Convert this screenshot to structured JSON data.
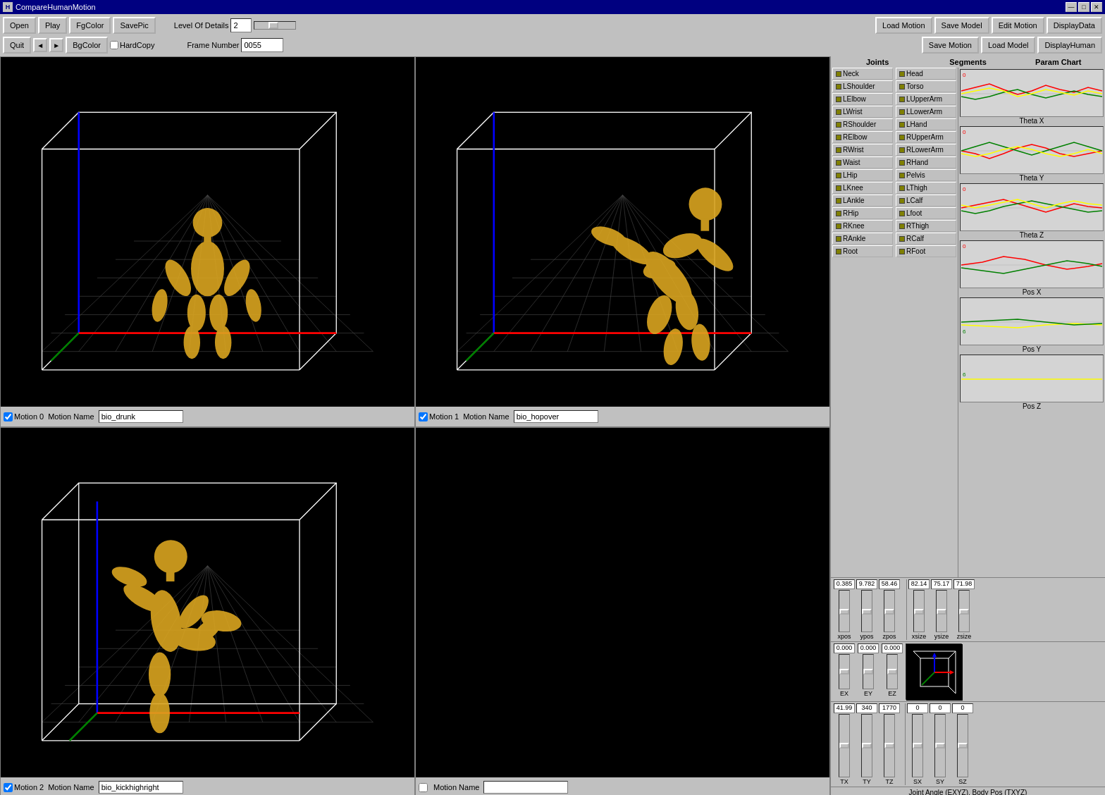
{
  "titleBar": {
    "title": "CompareHumanMotion",
    "minBtn": "—",
    "maxBtn": "□",
    "closeBtn": "✕"
  },
  "toolbar": {
    "row1": {
      "openBtn": "Open",
      "playBtn": "Play",
      "fgColorBtn": "FgColor",
      "savePicBtn": "SavePic",
      "levelLabel": "Level Of Details",
      "levelValue": "2",
      "loadMotionBtn": "Load Motion",
      "saveModelBtn": "Save Model",
      "editMotionBtn": "Edit Motion",
      "displayDataBtn": "DisplayData"
    },
    "row2": {
      "quitBtn": "Quit",
      "prevBtn": "◄",
      "nextBtn": "►",
      "bgColorBtn": "BgColor",
      "hardCopyChk": "HardCopy",
      "frameLabel": "Frame Number",
      "frameValue": "0055",
      "saveMotionBtn": "Save Motion",
      "loadModelBtn": "Load Model",
      "displayHumanBtn": "DisplayHuman"
    }
  },
  "panels": [
    {
      "id": "panel0",
      "motionId": "0",
      "motionLabel": "Motion 0",
      "motionName": "bio_drunk",
      "hasChecked": true
    },
    {
      "id": "panel1",
      "motionId": "1",
      "motionLabel": "Motion 1",
      "motionName": "bio_hopover",
      "hasChecked": true
    },
    {
      "id": "panel2",
      "motionId": "2",
      "motionLabel": "Motion 2",
      "motionName": "bio_kickhighright",
      "hasChecked": true
    },
    {
      "id": "panel3",
      "motionId": "3",
      "motionLabel": "",
      "motionName": "",
      "hasChecked": false
    }
  ],
  "joints": {
    "header": "Joints",
    "items": [
      "Neck",
      "LShoulder",
      "LElbow",
      "LWrist",
      "RShoulder",
      "RElbow",
      "RWrist",
      "Waist",
      "LHip",
      "LKnee",
      "LAnkle",
      "RHip",
      "RKnee",
      "RAnkle",
      "Root"
    ]
  },
  "segments": {
    "header": "Segments",
    "items": [
      "Head",
      "Torso",
      "LUpperArm",
      "LLowerArm",
      "LHand",
      "RUpperArm",
      "RLowerArm",
      "RHand",
      "Pelvis",
      "LThigh",
      "LCalf",
      "Lfoot",
      "RThigh",
      "RCalf",
      "RFoot"
    ]
  },
  "posSliders": {
    "xpos": {
      "label": "xpos",
      "value": "0.385"
    },
    "ypos": {
      "label": "ypos",
      "value": "9.782"
    },
    "zpos": {
      "label": "zpos",
      "value": "58.46"
    }
  },
  "sizeSliders": {
    "xsize": {
      "label": "xsize",
      "value": "82.14"
    },
    "ysize": {
      "label": "ysize",
      "value": "75.17"
    },
    "zsize": {
      "label": "zsize",
      "value": "71.98"
    }
  },
  "eulerSliders": {
    "EX": {
      "label": "EX",
      "value": "0.000"
    },
    "EY": {
      "label": "EY",
      "value": "0.000"
    },
    "EZ": {
      "label": "EZ",
      "value": "0.000"
    }
  },
  "bodySliders": {
    "TX": {
      "label": "TX",
      "value": "41.99"
    },
    "TY": {
      "label": "TY",
      "value": "340"
    },
    "TZ": {
      "label": "TZ",
      "value": "1770"
    },
    "SX": {
      "label": "SX",
      "value": "0"
    },
    "SY": {
      "label": "SY",
      "value": "0"
    },
    "SZ": {
      "label": "SZ",
      "value": "0"
    }
  },
  "paramChart": {
    "title": "Param Chart",
    "charts": [
      {
        "label": "Theta X"
      },
      {
        "label": "Theta Y"
      },
      {
        "label": "Theta Z"
      },
      {
        "label": "Pos X"
      },
      {
        "label": "Pos Y"
      },
      {
        "label": "Pos Z"
      }
    ]
  },
  "statusBar": {
    "text": "Joint Angle (EXYZ), Body Pos (TXYZ)"
  }
}
